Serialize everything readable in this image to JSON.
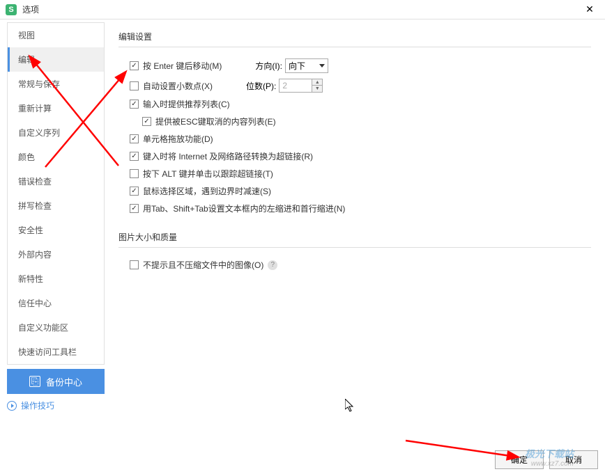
{
  "dialog": {
    "title": "选项",
    "logo_letter": "S"
  },
  "sidebar": {
    "items": [
      {
        "label": "视图"
      },
      {
        "label": "编辑",
        "active": true
      },
      {
        "label": "常规与保存"
      },
      {
        "label": "重新计算"
      },
      {
        "label": "自定义序列"
      },
      {
        "label": "颜色"
      },
      {
        "label": "错误检查"
      },
      {
        "label": "拼写检查"
      },
      {
        "label": "安全性"
      },
      {
        "label": "外部内容"
      },
      {
        "label": "新特性"
      },
      {
        "label": "信任中心"
      },
      {
        "label": "自定义功能区"
      },
      {
        "label": "快速访问工具栏"
      }
    ],
    "backup_label": "备份中心",
    "tips_label": "操作技巧"
  },
  "sections": {
    "edit": {
      "title": "编辑设置",
      "items": {
        "enter_move": {
          "label": "按 Enter 键后移动(M)",
          "checked": true
        },
        "direction_label": "方向(I):",
        "direction_value": "向下",
        "auto_decimal": {
          "label": "自动设置小数点(X)",
          "checked": false
        },
        "places_label": "位数(P):",
        "places_value": "2",
        "recommend_list": {
          "label": "输入时提供推荐列表(C)",
          "checked": true
        },
        "esc_content": {
          "label": "提供被ESC键取消的内容列表(E)",
          "checked": true
        },
        "cell_drag": {
          "label": "单元格拖放功能(D)",
          "checked": true
        },
        "url_hyperlink": {
          "label": "键入时将 Internet 及网络路径转换为超链接(R)",
          "checked": true
        },
        "alt_click": {
          "label": "按下 ALT 键并单击以跟踪超链接(T)",
          "checked": false
        },
        "mouse_select": {
          "label": "鼠标选择区域，遇到边界时减速(S)",
          "checked": true
        },
        "tab_indent": {
          "label": "用Tab、Shift+Tab设置文本框内的左缩进和首行缩进(N)",
          "checked": true
        }
      }
    },
    "image": {
      "title": "图片大小和质量",
      "items": {
        "no_compress": {
          "label": "不提示且不压缩文件中的图像(O)",
          "checked": false
        }
      }
    }
  },
  "buttons": {
    "ok": "确定",
    "cancel": "取消"
  },
  "watermark": {
    "line1": "极光下载站",
    "line2": "www.xz7.com"
  }
}
